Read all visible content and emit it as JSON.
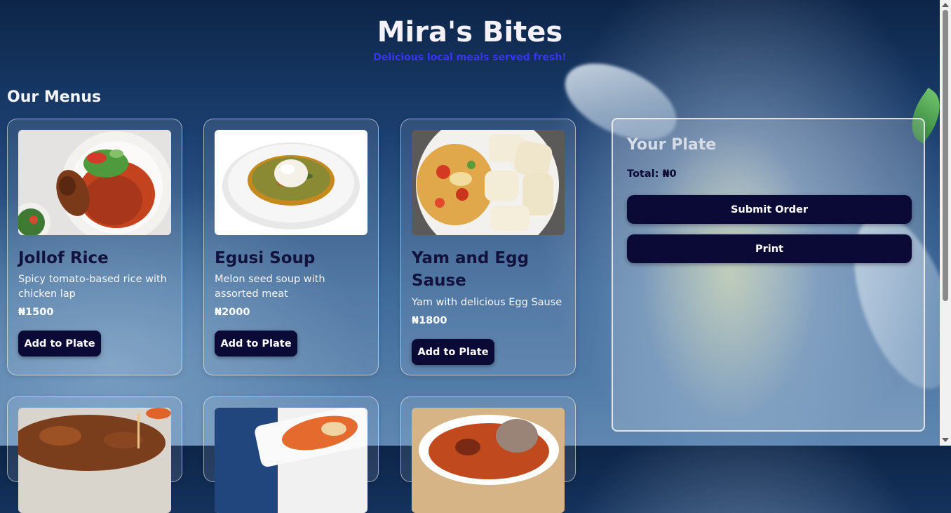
{
  "header": {
    "title": "Mira's Bites",
    "tagline": "Delicious local meals served fresh!"
  },
  "menu_section": {
    "title": "Our Menus",
    "add_label": "Add to Plate",
    "items": [
      {
        "name": "Jollof Rice",
        "description": "Spicy tomato-based rice with chicken lap",
        "price": "₦1500"
      },
      {
        "name": "Egusi Soup",
        "description": "Melon seed soup with assorted meat",
        "price": "₦2000"
      },
      {
        "name": "Yam and Egg Sause",
        "description": "Yam with delicious Egg Sause",
        "price": "₦1800"
      }
    ]
  },
  "plate": {
    "title": "Your Plate",
    "total": "Total: ₦0",
    "submit_label": "Submit Order",
    "print_label": "Print"
  },
  "colors": {
    "button_bg": "#0b0a36",
    "tagline": "#3a36e8",
    "title": "#f5f1f8"
  },
  "icons": [
    "scroll-up-arrow-icon",
    "scroll-down-arrow-icon"
  ]
}
